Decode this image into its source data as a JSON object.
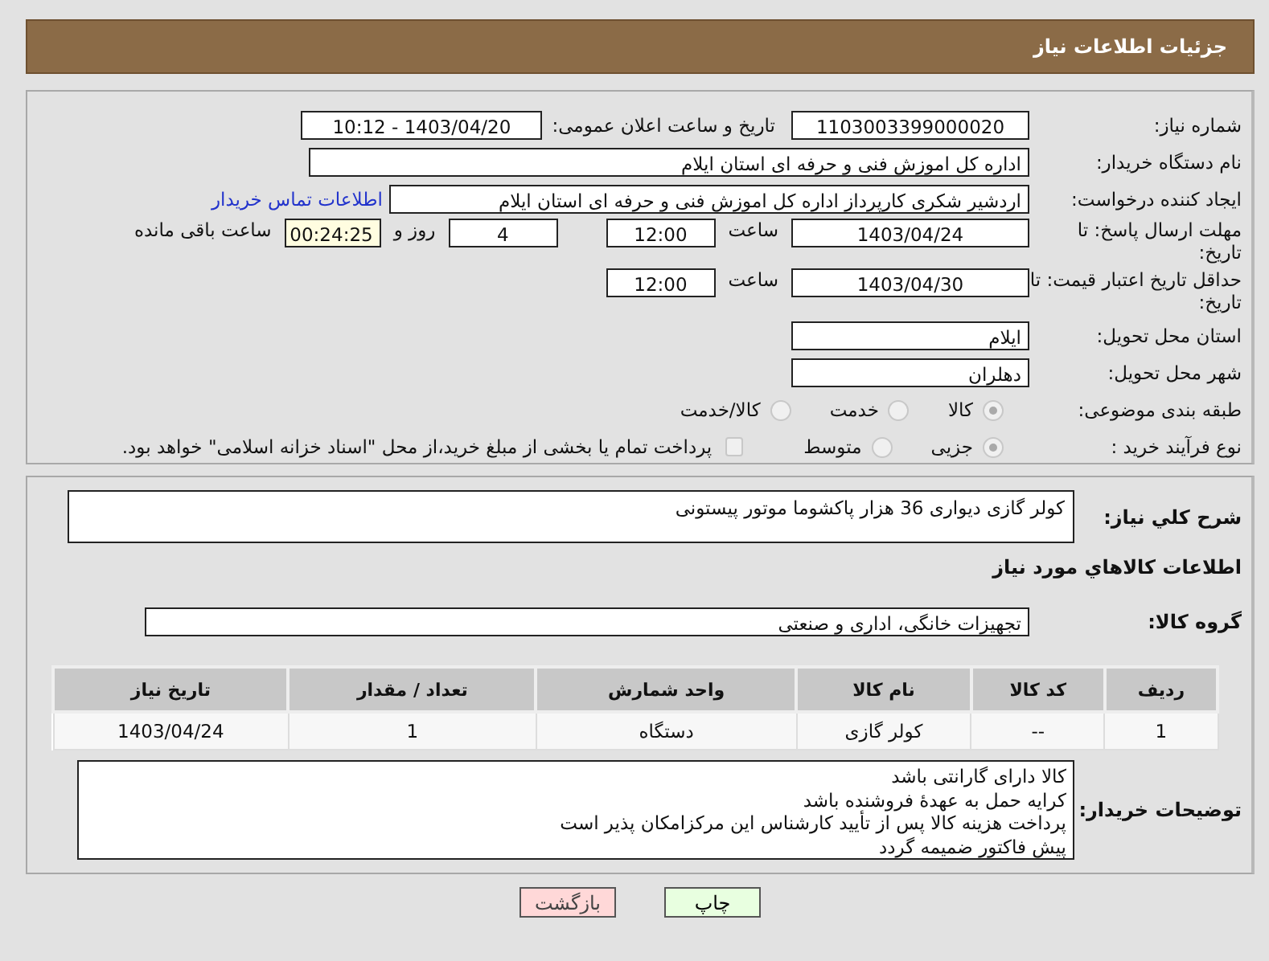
{
  "header": {
    "title": "جزئیات اطلاعات نیاز"
  },
  "need_number": {
    "label": "شماره نیاز:",
    "value": "1103003399000020"
  },
  "announce": {
    "label": "تاریخ و ساعت اعلان عمومی:",
    "value": "1403/04/20 - 10:12"
  },
  "buyer_org": {
    "label": "نام دستگاه خریدار:",
    "value": "اداره کل اموزش فنی و حرفه ای استان ایلام"
  },
  "requester": {
    "label": "ایجاد کننده درخواست:",
    "value": "اردشیر شکری کارپرداز اداره کل اموزش فنی و حرفه ای استان ایلام",
    "link": "اطلاعات تماس خریدار"
  },
  "reply_deadline": {
    "label": "مهلت ارسال پاسخ: تا تاریخ:",
    "date": "1403/04/24",
    "time_label": "ساعت",
    "time": "12:00",
    "days": "4",
    "days_label": "روز و",
    "remaining": "00:24:25",
    "remaining_label": "ساعت باقی مانده"
  },
  "price_validity": {
    "label": "حداقل تاریخ اعتبار قیمت: تا تاریخ:",
    "date": "1403/04/30",
    "time_label": "ساعت",
    "time": "12:00"
  },
  "province": {
    "label": "استان محل تحویل:",
    "value": "ایلام"
  },
  "city": {
    "label": "شهر محل تحویل:",
    "value": "دهلران"
  },
  "category": {
    "label": "طبقه بندی موضوعی:",
    "options": [
      {
        "label": "کالا",
        "selected": true
      },
      {
        "label": "خدمت",
        "selected": false
      },
      {
        "label": "کالا/خدمت",
        "selected": false
      }
    ]
  },
  "process": {
    "label": "نوع فرآیند خرید :",
    "options": [
      {
        "label": "جزیی",
        "selected": true
      },
      {
        "label": "متوسط",
        "selected": false
      }
    ],
    "treasury": {
      "checked": false,
      "label": "پرداخت تمام یا بخشی از مبلغ خرید،از محل \"اسناد خزانه اسلامی\" خواهد بود."
    }
  },
  "description": {
    "label": "شرح کلي نياز:",
    "value": "کولر گازی دیواری 36 هزار پاکشوما موتور پیستونی"
  },
  "goods_heading": "اطلاعات کالاهاي مورد نياز",
  "goods_group": {
    "label": "گروه کالا:",
    "value": "تجهیزات خانگی، اداری و صنعتی"
  },
  "table": {
    "columns": [
      "ردیف",
      "کد کالا",
      "نام کالا",
      "واحد شمارش",
      "تعداد / مقدار",
      "تاریخ نیاز"
    ],
    "rows": [
      [
        "1",
        "--",
        "کولر گازی",
        "دستگاه",
        "1",
        "1403/04/24"
      ]
    ]
  },
  "buyer_notes": {
    "label": "توضیحات خریدار:",
    "lines": [
      "کالا دارای گارانتی باشد",
      "کرایه حمل به عهدهٔ فروشنده باشد",
      "پرداخت هزینه کالا پس از تأیید کارشناس این مرکزامکان پذیر است",
      "پیش فاکتور ضمیمه گردد"
    ]
  },
  "buttons": [
    {
      "kind": "print",
      "label": "چاپ"
    },
    {
      "kind": "back",
      "label": "بازگشت"
    }
  ]
}
